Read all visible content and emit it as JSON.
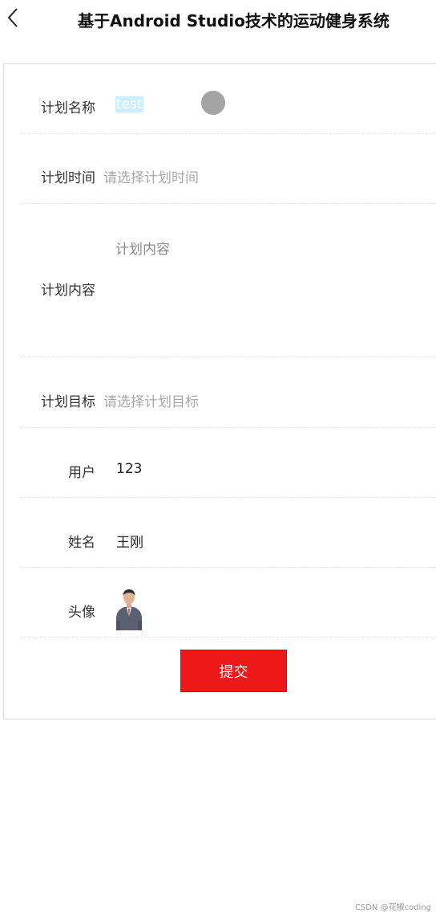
{
  "header": {
    "back_icon": "chevron-left-icon",
    "title": "基于Android Studio技术的运动健身系统"
  },
  "form": {
    "plan_name": {
      "label": "计划名称",
      "value": "test"
    },
    "plan_time": {
      "label": "计划时间",
      "placeholder": "请选择计划时间"
    },
    "plan_content": {
      "label": "计划内容",
      "placeholder": "计划内容"
    },
    "plan_goal": {
      "label": "计划目标",
      "placeholder": "请选择计划目标"
    },
    "user": {
      "label": "用户",
      "value": "123"
    },
    "name": {
      "label": "姓名",
      "value": "王刚"
    },
    "avatar": {
      "label": "头像"
    },
    "submit_label": "提交"
  },
  "colors": {
    "accent": "#ef1818",
    "selection": "#cdeeff",
    "placeholder": "#a8a8a8"
  },
  "watermark": "CSDN @花椒coding"
}
